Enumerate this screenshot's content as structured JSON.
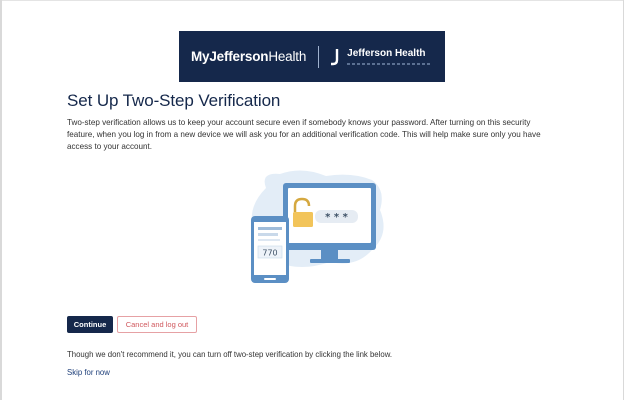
{
  "brand": {
    "app_name_bold": "MyJefferson",
    "app_name_light": "Health",
    "org_name": "Jefferson Health",
    "logo_icon": "jefferson-j-icon",
    "banner_color": "#15284b"
  },
  "page": {
    "title": "Set Up Two-Step Verification",
    "description": "Two-step verification allows us to keep your account secure even if somebody knows your password. After turning on this security feature, when you log in from a new device we will ask you for an additional verification code. This will help make sure only you have access to your account."
  },
  "illustration": {
    "password_mask": "* * *",
    "phone_code": "770",
    "icons": [
      "phone-icon",
      "monitor-icon",
      "padlock-icon"
    ]
  },
  "actions": {
    "continue_label": "Continue",
    "cancel_label": "Cancel and log out"
  },
  "footer": {
    "note": "Though we don't recommend it, you can turn off two-step verification by clicking the link below.",
    "skip_label": "Skip for now"
  },
  "colors": {
    "primary": "#15284b",
    "danger": "#d0585d",
    "link": "#1e3f7a"
  }
}
